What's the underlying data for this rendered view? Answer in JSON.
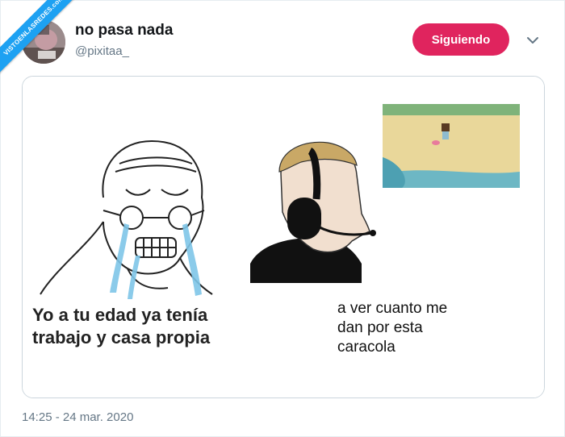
{
  "watermark": "VISTOENLASREDES.com",
  "user": {
    "display_name": "no pasa nada",
    "handle": "@pixitaa_"
  },
  "follow_button": {
    "label": "Siguiendo",
    "color": "#e0245e"
  },
  "menu_icon": "chevron-down-icon",
  "meme": {
    "left_caption_line1": "Yo a tu edad ya tenía",
    "left_caption_line2": "trabajo y casa propia",
    "right_caption_line1": "a ver cuanto me",
    "right_caption_line2": "dan por esta",
    "right_caption_line3": "caracola"
  },
  "timestamp": "14:25 - 24 mar. 2020",
  "colors": {
    "accent": "#1da1f2",
    "follow": "#e0245e",
    "muted": "#657786"
  }
}
